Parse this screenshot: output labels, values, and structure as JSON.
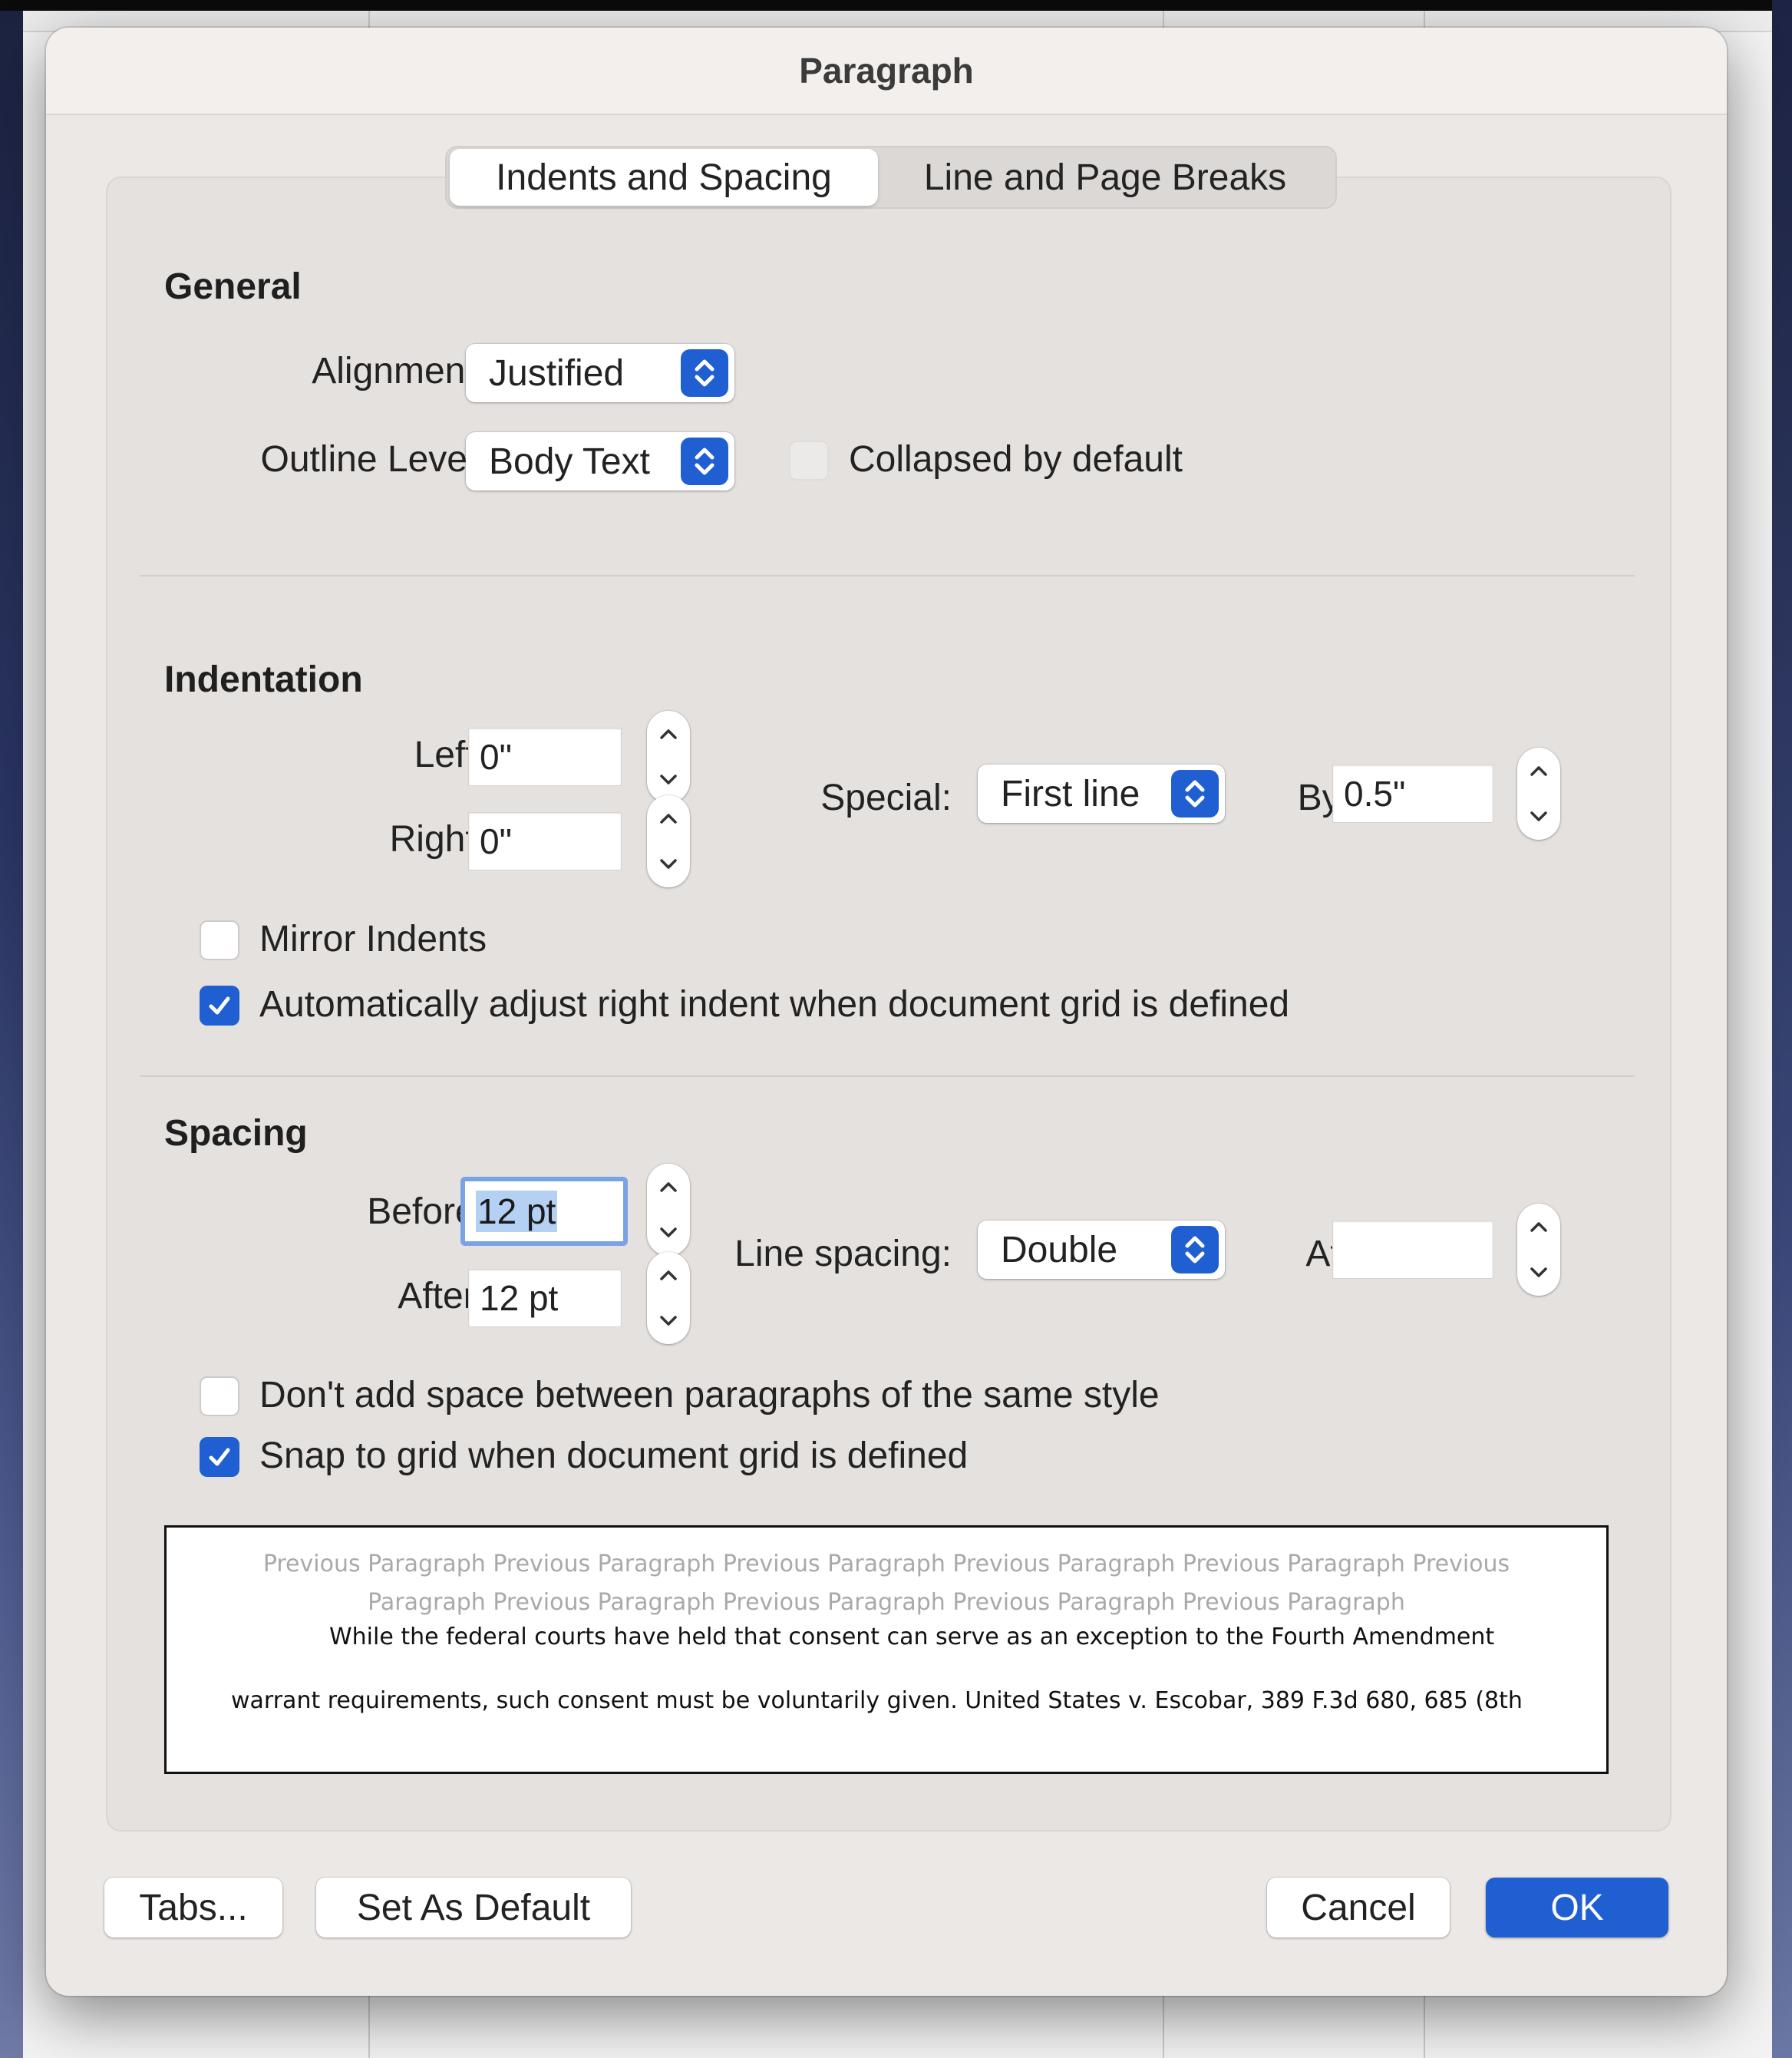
{
  "dialog": {
    "title": "Paragraph"
  },
  "tabs": [
    {
      "label": "Indents and Spacing",
      "active": true
    },
    {
      "label": "Line and Page Breaks",
      "active": false
    }
  ],
  "general": {
    "heading": "General",
    "alignment_label": "Alignment:",
    "alignment_value": "Justified",
    "outline_label": "Outline Level:",
    "outline_value": "Body Text",
    "collapsed_label": "Collapsed by default",
    "collapsed_checked": false,
    "collapsed_enabled": false
  },
  "indentation": {
    "heading": "Indentation",
    "left_label": "Left:",
    "left_value": "0\"",
    "right_label": "Right:",
    "right_value": "0\"",
    "special_label": "Special:",
    "special_value": "First line",
    "by_label": "By:",
    "by_value": "0.5\"",
    "mirror_label": "Mirror Indents",
    "mirror_checked": false,
    "auto_adjust_label": "Automatically adjust right indent when document grid is defined",
    "auto_adjust_checked": true
  },
  "spacing": {
    "heading": "Spacing",
    "before_label": "Before:",
    "before_value": "12 pt",
    "after_label": "After:",
    "after_value": "12 pt",
    "line_spacing_label": "Line spacing:",
    "line_spacing_value": "Double",
    "at_label": "At:",
    "at_value": "",
    "dont_add_label": "Don't add space between paragraphs of the same style",
    "dont_add_checked": false,
    "snap_label": "Snap to grid when document grid is defined",
    "snap_checked": true
  },
  "preview": {
    "previous_line_1": "Previous Paragraph Previous Paragraph Previous Paragraph Previous Paragraph Previous Paragraph Previous",
    "previous_line_2": "Paragraph Previous Paragraph Previous Paragraph Previous Paragraph Previous Paragraph",
    "sample_line_1": "While the federal courts have held that consent can serve as an exception to the Fourth Amendment",
    "sample_line_2": "warrant requirements, such consent must be voluntarily given.  United States v. Escobar, 389 F.3d 680, 685 (8th"
  },
  "buttons": {
    "tabs": "Tabs...",
    "set_default": "Set As Default",
    "cancel": "Cancel",
    "ok": "OK"
  },
  "colors": {
    "accent": "#1f5fd1",
    "focus_ring": "#7aa2e6",
    "dialog_bg": "#ece8e6"
  },
  "icons": {
    "popup_arrows": "chevron-up-down-icon",
    "stepper_up": "chevron-up-icon",
    "stepper_down": "chevron-down-icon",
    "checkmark": "checkmark-icon"
  }
}
